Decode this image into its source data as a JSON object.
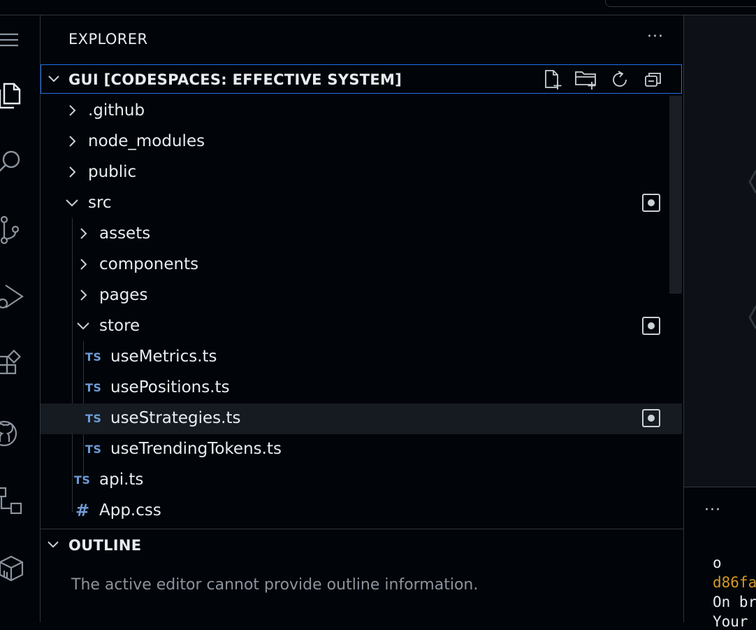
{
  "explorer": {
    "header": "EXPLORER",
    "more": "···",
    "section_title": "GUI [CODESPACES: EFFECTIVE SYSTEM]",
    "tree": [
      {
        "label": ".github",
        "type": "folder",
        "expanded": false
      },
      {
        "label": "node_modules",
        "type": "folder",
        "expanded": false
      },
      {
        "label": "public",
        "type": "folder",
        "expanded": false
      },
      {
        "label": "src",
        "type": "folder",
        "expanded": true,
        "modified": true
      },
      {
        "label": "assets",
        "type": "folder",
        "expanded": false
      },
      {
        "label": "components",
        "type": "folder",
        "expanded": false
      },
      {
        "label": "pages",
        "type": "folder",
        "expanded": false
      },
      {
        "label": "store",
        "type": "folder",
        "expanded": true,
        "modified": true
      },
      {
        "label": "useMetrics.ts",
        "type": "ts",
        "icon_text": "TS"
      },
      {
        "label": "usePositions.ts",
        "type": "ts",
        "icon_text": "TS"
      },
      {
        "label": "useStrategies.ts",
        "type": "ts",
        "icon_text": "TS",
        "selected": true,
        "modified": true
      },
      {
        "label": "useTrendingTokens.ts",
        "type": "ts",
        "icon_text": "TS"
      },
      {
        "label": "api.ts",
        "type": "ts",
        "icon_text": "TS"
      },
      {
        "label": "App.css",
        "type": "css",
        "icon_text": "#"
      }
    ]
  },
  "outline": {
    "title": "OUTLINE",
    "message": "The active editor cannot provide outline information."
  },
  "panel": {
    "more": "···",
    "terminal_lines": [
      "o",
      "d86fa",
      "On br",
      "Your"
    ]
  },
  "colors": {
    "background": "#010409",
    "focus_border": "#1f6feb",
    "ts_icon": "#6f9bd6",
    "hash_text": "#d29922",
    "selected_row": "#161b22"
  }
}
